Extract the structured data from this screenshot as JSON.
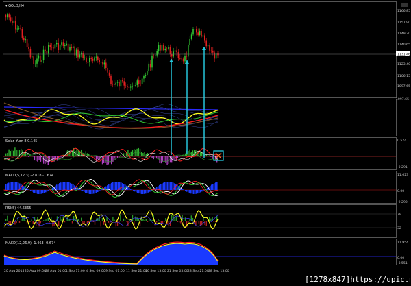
{
  "chart": {
    "symbol_label": "▾ GOLD,H4",
    "price_labels": [
      "1166.85",
      "1157.90",
      "1149.20",
      "1140.65",
      "1131.46",
      "1123.40",
      "1106.15",
      "1097.65"
    ],
    "current_price": "1131.46",
    "x_labels": [
      "20 Aug 2015",
      "25 Aug 09:00",
      "28 Aug 01:00",
      "1 Sep 17:00",
      "4 Sep 09:00",
      "9 Sep 01:00",
      "11 Sep 21:00",
      "16 Sep 13:00",
      "21 Sep 05:00",
      "23 Sep 21:00",
      "28 Sep 13:00"
    ]
  },
  "panels": {
    "p2": {
      "title": ""
    },
    "p3": {
      "title": "Solar_Yum 8 0.145",
      "labels": [
        "0.574",
        "-0.291"
      ]
    },
    "p4": {
      "title": "MACD(5,12,3) -2.818 -1.674",
      "labels": [
        "11.623",
        "0.00",
        "-9.292"
      ]
    },
    "p5": {
      "title": "RSI(5) 44.6365",
      "labels": [
        "79",
        "32"
      ]
    },
    "p6": {
      "title": "MACD(12,26,9) -1.463 -0.674",
      "labels": [
        "11.954",
        "0.00",
        "-8.551"
      ]
    }
  },
  "watermark": "[1278x847]https://upic.me/",
  "colors": {
    "bull": "#32c832",
    "bear": "#e02020",
    "arrow": "#26c6da",
    "grid": "#5a5a5a"
  }
}
